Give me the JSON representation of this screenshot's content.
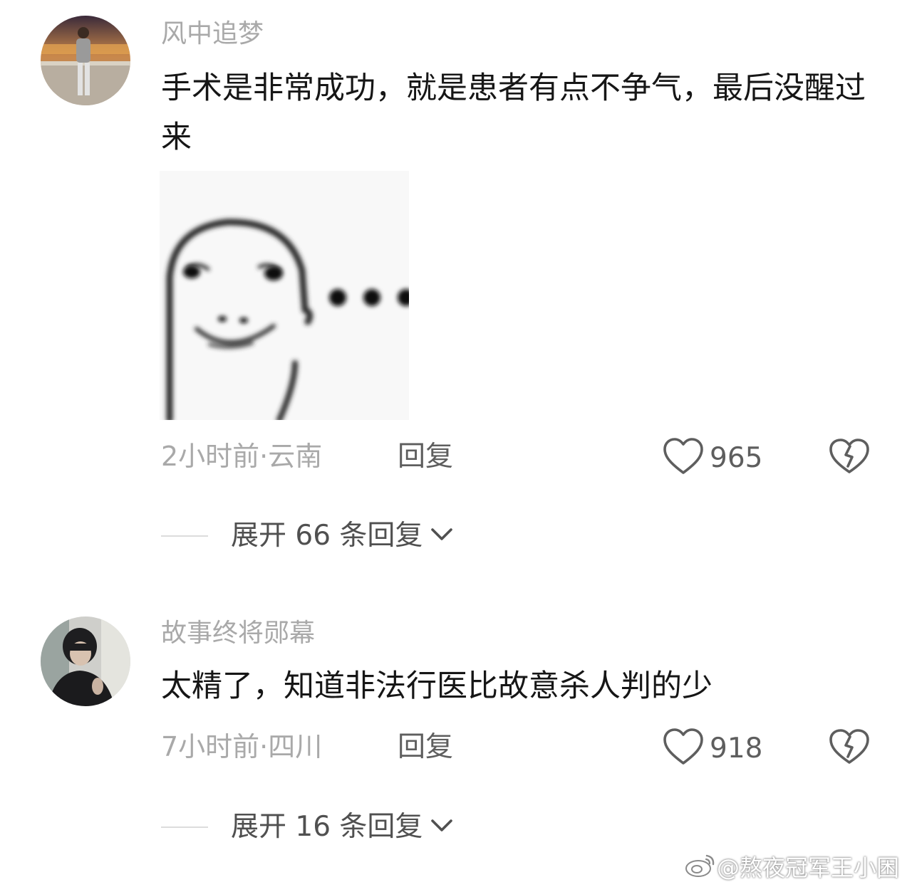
{
  "comments": [
    {
      "username": "风中追梦",
      "text": "手术是非常成功，就是患者有点不争气，最后没醒过来",
      "time_location": "2小时前·云南",
      "reply_label": "回复",
      "likes": "965",
      "expand_label": "展开 66 条回复",
      "has_sticker": true
    },
    {
      "username": "故事终将郧幕",
      "text": "太精了，知道非法行医比故意杀人判的少",
      "time_location": "7小时前·四川",
      "reply_label": "回复",
      "likes": "918",
      "expand_label": "展开 16 条回复",
      "has_sticker": false
    }
  ],
  "watermark": "@熬夜冠军王小困",
  "icons": {
    "like": "heart-outline-icon",
    "dislike": "broken-heart-icon",
    "expand": "chevron-down-icon",
    "watermark": "weibo-logo-icon"
  },
  "colors": {
    "username": "#a9a9a9",
    "text": "#161616",
    "action": "#5e5e5e"
  }
}
